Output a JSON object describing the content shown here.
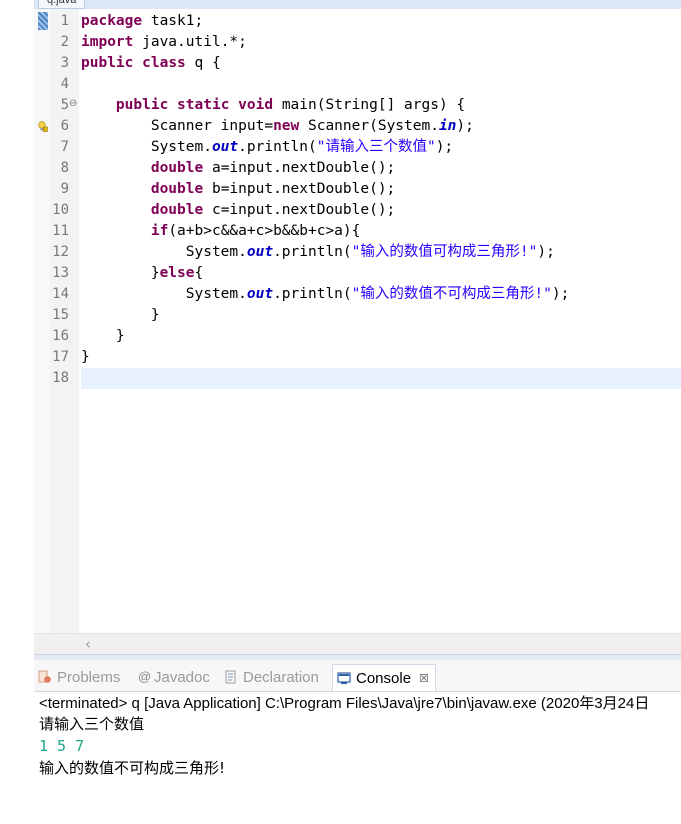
{
  "editor": {
    "tab_title": "q.java",
    "line_numbers": [
      "1",
      "2",
      "3",
      "4",
      "5",
      "6",
      "7",
      "8",
      "9",
      "10",
      "11",
      "12",
      "13",
      "14",
      "15",
      "16",
      "17",
      "18"
    ],
    "lines": [
      [
        {
          "t": "package",
          "c": "kw"
        },
        {
          "t": " task1;",
          "c": ""
        }
      ],
      [
        {
          "t": "import",
          "c": "kw"
        },
        {
          "t": " java.util.*;",
          "c": ""
        }
      ],
      [
        {
          "t": "public",
          "c": "kw"
        },
        {
          "t": " ",
          "c": ""
        },
        {
          "t": "class",
          "c": "kw"
        },
        {
          "t": " q {",
          "c": ""
        }
      ],
      [],
      [
        {
          "t": "    ",
          "c": ""
        },
        {
          "t": "public",
          "c": "kw"
        },
        {
          "t": " ",
          "c": ""
        },
        {
          "t": "static",
          "c": "kw"
        },
        {
          "t": " ",
          "c": ""
        },
        {
          "t": "void",
          "c": "kw"
        },
        {
          "t": " main(String[] args) {",
          "c": ""
        }
      ],
      [
        {
          "t": "        Scanner input=",
          "c": ""
        },
        {
          "t": "new",
          "c": "kw"
        },
        {
          "t": " Scanner(System.",
          "c": ""
        },
        {
          "t": "in",
          "c": "fld"
        },
        {
          "t": ");",
          "c": ""
        }
      ],
      [
        {
          "t": "        System.",
          "c": ""
        },
        {
          "t": "out",
          "c": "fld"
        },
        {
          "t": ".println(",
          "c": ""
        },
        {
          "t": "\"请输入三个数值\"",
          "c": "str"
        },
        {
          "t": ");",
          "c": ""
        }
      ],
      [
        {
          "t": "        ",
          "c": ""
        },
        {
          "t": "double",
          "c": "kw"
        },
        {
          "t": " a=input.nextDouble();",
          "c": ""
        }
      ],
      [
        {
          "t": "        ",
          "c": ""
        },
        {
          "t": "double",
          "c": "kw"
        },
        {
          "t": " b=input.nextDouble();",
          "c": ""
        }
      ],
      [
        {
          "t": "        ",
          "c": ""
        },
        {
          "t": "double",
          "c": "kw"
        },
        {
          "t": " c=input.nextDouble();",
          "c": ""
        }
      ],
      [
        {
          "t": "        ",
          "c": ""
        },
        {
          "t": "if",
          "c": "kw"
        },
        {
          "t": "(a+b>c&&a+c>b&&b+c>a){",
          "c": ""
        }
      ],
      [
        {
          "t": "            System.",
          "c": ""
        },
        {
          "t": "out",
          "c": "fld"
        },
        {
          "t": ".println(",
          "c": ""
        },
        {
          "t": "\"输入的数值可构成三角形!\"",
          "c": "str"
        },
        {
          "t": ");",
          "c": ""
        }
      ],
      [
        {
          "t": "        }",
          "c": ""
        },
        {
          "t": "else",
          "c": "kw"
        },
        {
          "t": "{",
          "c": ""
        }
      ],
      [
        {
          "t": "            System.",
          "c": ""
        },
        {
          "t": "out",
          "c": "fld"
        },
        {
          "t": ".println(",
          "c": ""
        },
        {
          "t": "\"输入的数值不可构成三角形!\"",
          "c": "str"
        },
        {
          "t": ");",
          "c": ""
        }
      ],
      [
        {
          "t": "        }",
          "c": ""
        }
      ],
      [
        {
          "t": "    }",
          "c": ""
        }
      ],
      [
        {
          "t": "}",
          "c": ""
        }
      ],
      []
    ]
  },
  "views": {
    "tabs": [
      {
        "id": "problems",
        "label": "Problems",
        "icon": "problems-icon",
        "active": false
      },
      {
        "id": "javadoc",
        "label": "Javadoc",
        "icon": "at-icon",
        "active": false
      },
      {
        "id": "declaration",
        "label": "Declaration",
        "icon": "declaration-icon",
        "active": false
      },
      {
        "id": "console",
        "label": "Console",
        "icon": "console-icon",
        "active": true
      }
    ],
    "close_glyph": "☒"
  },
  "console": {
    "status": "<terminated> q [Java Application] C:\\Program Files\\Java\\jre7\\bin\\javaw.exe (2020年3月24日",
    "output_lines": [
      {
        "text": "请输入三个数值",
        "kind": "out"
      },
      {
        "text": "1 5 7",
        "kind": "in"
      },
      {
        "text": "输入的数值不可构成三角形!",
        "kind": "out"
      }
    ]
  },
  "colors": {
    "keyword": "#7f0055",
    "string": "#2a00ff",
    "static_field": "#0000c0",
    "console_input": "#1fa88a",
    "current_line": "#e8f2fe"
  }
}
